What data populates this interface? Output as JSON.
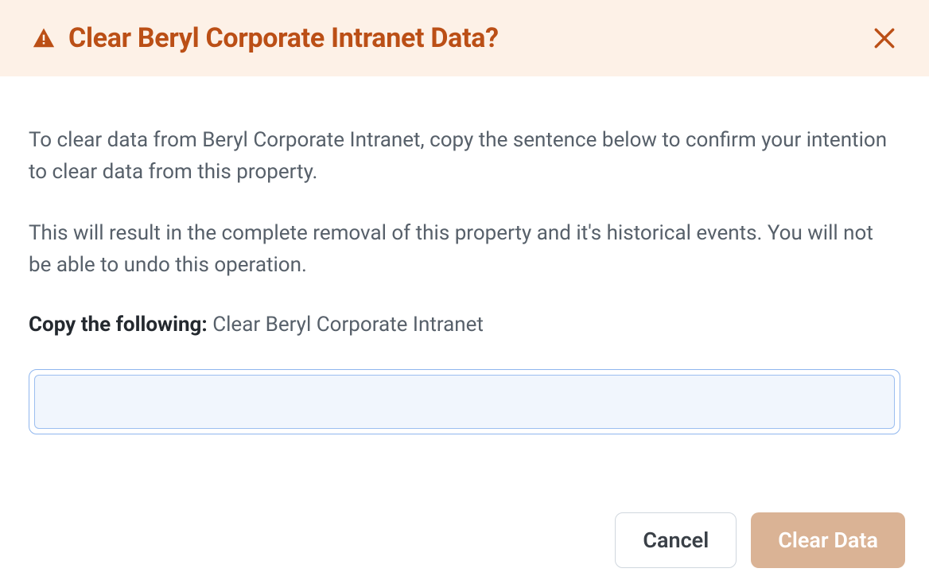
{
  "header": {
    "title": "Clear Beryl Corporate Intranet Data?"
  },
  "body": {
    "description1": "To clear data from Beryl Corporate Intranet, copy the sentence below to confirm your intention to clear data from this property.",
    "description2": "This will result in the complete removal of this property and it's historical events. You will not be able to undo this operation.",
    "copy_label": "Copy the following:",
    "copy_text": "Clear Beryl Corporate Intranet",
    "input_value": ""
  },
  "footer": {
    "cancel_label": "Cancel",
    "clear_label": "Clear Data"
  },
  "colors": {
    "accent": "#bb4f16",
    "header_bg": "#fdf1e7",
    "input_focus_bg": "#f1f6fd",
    "input_focus_border": "#8fb6ee",
    "clear_btn_bg": "#dab395"
  }
}
